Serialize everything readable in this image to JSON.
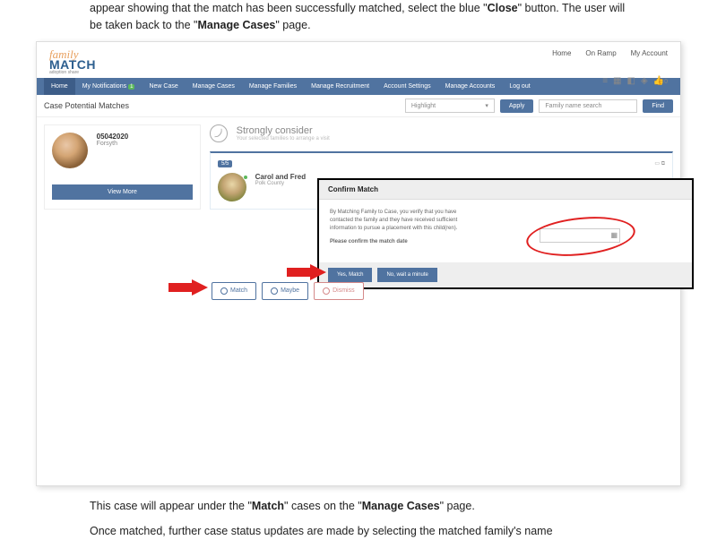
{
  "doc": {
    "top_line": "appear showing that the match has been successfully matched, select the blue \"",
    "top_bold_close": "Close",
    "top_after_close": "\" button. The user will be taken back to the \"",
    "top_bold_manage": "Manage Cases",
    "top_after_manage": "\" page.",
    "bottom_line1_a": "This case will appear under the \"",
    "bottom_line1_b": "Match",
    "bottom_line1_c": "\" cases on the \"",
    "bottom_line1_d": "Manage Cases",
    "bottom_line1_e": "\" page.",
    "bottom_line2": "Once matched, further case status updates are made by selecting the matched family's name"
  },
  "app": {
    "logo": {
      "top": "family",
      "bottom": "MATCH",
      "sub": "adoption share"
    },
    "top_links": [
      "Home",
      "On Ramp",
      "My Account"
    ],
    "nav": [
      "Home",
      "My Notifications",
      "New Case",
      "Manage Cases",
      "Manage Families",
      "Manage Recruitment",
      "Account Settings",
      "Manage Accounts",
      "Log out"
    ],
    "nav_badge": "1",
    "page_title": "Case Potential Matches",
    "highlight_label": "Highlight",
    "apply_btn": "Apply",
    "search_placeholder": "Family name search",
    "find_btn": "Find",
    "thumb_count": "0",
    "case": {
      "id": "05042020",
      "location": "Forsyth",
      "view_more": "View More"
    },
    "strongly": {
      "title": "Strongly consider",
      "sub": "Your selected families to arrange a visit"
    },
    "family": {
      "score": "5/5",
      "name": "Carol and Fred",
      "location": "Polk County"
    },
    "modal": {
      "title": "Confirm Match",
      "body1": "By Matching Family to Case, you verify that you have contacted the family and they have received sufficient information to pursue a placement with this child(ren).",
      "body2": "Please confirm the match date",
      "btn_yes": "Yes, Match",
      "btn_no": "No, wait a minute"
    },
    "actions": {
      "match": "Match",
      "maybe": "Maybe",
      "dismiss": "Dismiss"
    }
  }
}
